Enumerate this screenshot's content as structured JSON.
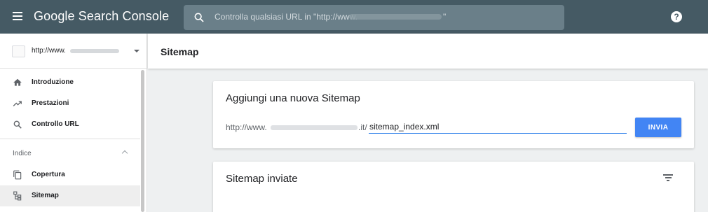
{
  "app": {
    "title": "Google Search Console"
  },
  "search": {
    "placeholder_start": "Controlla qualsiasi URL in \"http://www.",
    "placeholder_end": "\""
  },
  "property": {
    "url_start": "http://www."
  },
  "sidebar": {
    "items": [
      {
        "label": "Introduzione",
        "icon": "home-icon"
      },
      {
        "label": "Prestazioni",
        "icon": "trending-up-icon"
      },
      {
        "label": "Controllo URL",
        "icon": "search-icon"
      }
    ],
    "section_label": "Indice",
    "section_items": [
      {
        "label": "Copertura",
        "icon": "copy-icon"
      },
      {
        "label": "Sitemap",
        "icon": "sitemap-icon",
        "active": true
      }
    ]
  },
  "main": {
    "page_title": "Sitemap",
    "add_card": {
      "title": "Aggiungi una nuova Sitemap",
      "prefix": "http://www.",
      "suffix": ".it/",
      "input_value": "sitemap_index.xml",
      "submit_label": "INVIA"
    },
    "submitted_card": {
      "title": "Sitemap inviate"
    }
  },
  "colors": {
    "topbar": "#455a64",
    "accent": "#4285f4",
    "input_underline": "#1a73e8"
  }
}
